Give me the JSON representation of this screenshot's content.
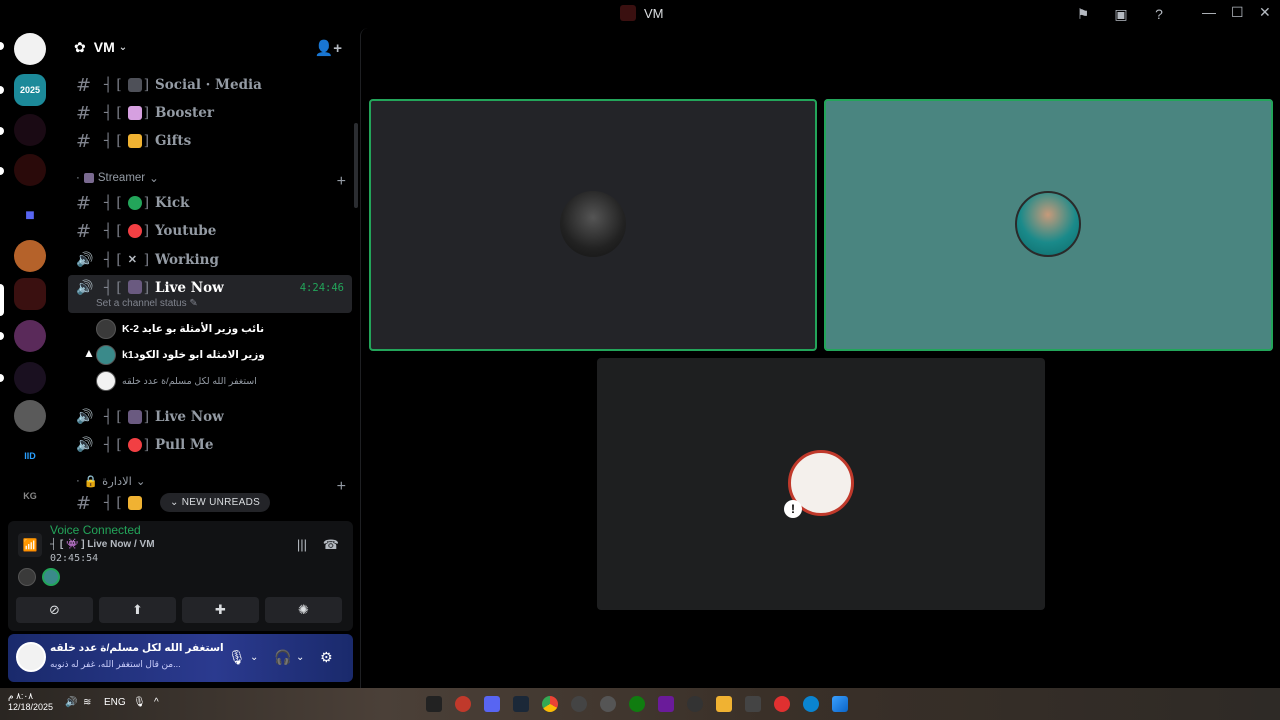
{
  "window": {
    "title": "VM"
  },
  "guild": {
    "name": "VM"
  },
  "channels": [
    {
      "name": "Social · Media",
      "type": "text",
      "emoji_color": "#dbdee1"
    },
    {
      "name": "Booster",
      "type": "text",
      "emoji_color": "#d6a0e0"
    },
    {
      "name": "Gifts",
      "type": "text",
      "emoji_color": "#f0b232"
    }
  ],
  "category_streamer": {
    "label": "Streamer"
  },
  "streamer_channels": [
    {
      "name": "Kick",
      "type": "text",
      "emoji_color": "#23a55a"
    },
    {
      "name": "Youtube",
      "type": "text",
      "emoji_color": "#f23f43"
    },
    {
      "name": "Working",
      "type": "voice",
      "emoji_color": "#b5bac1"
    }
  ],
  "active_channel": {
    "name": "Live Now",
    "timer": "4:24:46",
    "status_placeholder": "Set a channel status"
  },
  "voice_users": [
    {
      "name": "K-2 نائب وزير الأمثلة بو عايد"
    },
    {
      "name": "k1وزير الامثله ابو خلود الكود"
    },
    {
      "name": "استغفر الله لكل مسلم/ة عدد خلقه"
    }
  ],
  "more_channels": [
    {
      "name": "Live Now",
      "type": "voice",
      "emoji_color": "#b5bac1"
    },
    {
      "name": "Pull Me",
      "type": "voice",
      "emoji_color": "#f23f43"
    }
  ],
  "category_admin": {
    "label": "الادارة"
  },
  "new_unreads": "NEW UNREADS",
  "voice_panel": {
    "label": "Voice Connected",
    "channel": "┤ [ 👾 ] Live Now / VM",
    "elapsed": "02:45:54"
  },
  "user_panel": {
    "name": "استغفر الله لكل مسلم/ة عدد خلقه",
    "status": "من قال استغفر الله، غفر له ذنوبه..."
  },
  "taskbar": {
    "time": "٨:٠٨ م",
    "date": "12/18/2025",
    "lang": "ENG"
  },
  "colors": {
    "speaking": "#23a55a",
    "tile_dark": "#232428",
    "tile_teal": "#4a8580",
    "tile_gray": "#1e1f20"
  }
}
